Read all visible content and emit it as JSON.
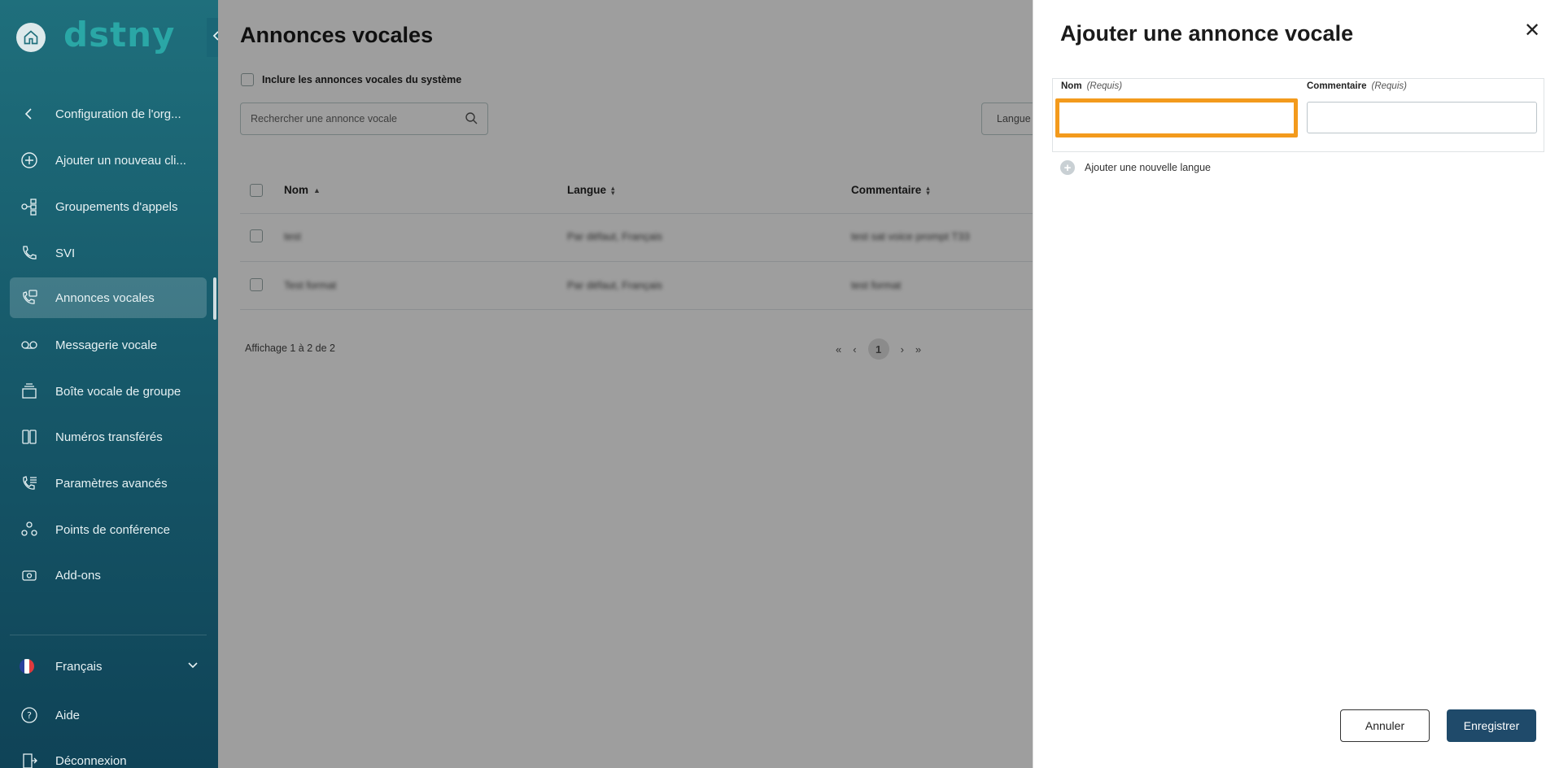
{
  "sidebar": {
    "logo": "dstny",
    "items": [
      {
        "label": "Configuration de l'org...",
        "icon": "chevron-left-icon"
      },
      {
        "label": "Ajouter un nouveau cli...",
        "icon": "plus-circle-icon"
      },
      {
        "label": "Groupements d'appels",
        "icon": "hunt-group-icon"
      },
      {
        "label": "SVI",
        "icon": "ivr-icon"
      },
      {
        "label": "Annonces vocales",
        "icon": "voice-announcement-icon",
        "active": true
      },
      {
        "label": "Messagerie vocale",
        "icon": "voicemail-icon"
      },
      {
        "label": "Boîte vocale de groupe",
        "icon": "group-voicemail-icon"
      },
      {
        "label": "Numéros transférés",
        "icon": "transferred-numbers-icon"
      },
      {
        "label": "Paramètres avancés",
        "icon": "advanced-settings-icon"
      },
      {
        "label": "Points de conférence",
        "icon": "conference-icon"
      },
      {
        "label": "Add-ons",
        "icon": "addons-icon"
      }
    ],
    "language": "Français",
    "help": "Aide",
    "logout": "Déconnexion"
  },
  "main": {
    "title": "Annonces vocales",
    "include_system_label": "Inclure les annonces vocales du système",
    "search_placeholder": "Rechercher une annonce vocale",
    "language_filter": "Langue",
    "columns": [
      "Nom",
      "Langue",
      "Commentaire"
    ],
    "rows": [
      {
        "name": "test",
        "language": "Par défaut, Français",
        "comment": "test sat voice prompt T33"
      },
      {
        "name": "Test format",
        "language": "Par défaut, Français",
        "comment": "test format"
      }
    ],
    "pagination_info": "Affichage 1 à 2 de 2",
    "current_page": "1"
  },
  "panel": {
    "title": "Ajouter une annonce vocale",
    "name_label": "Nom",
    "name_required": "(Requis)",
    "comment_label": "Commentaire",
    "comment_required": "(Requis)",
    "name_value": "",
    "comment_value": "",
    "add_language": "Ajouter une nouvelle langue",
    "cancel": "Annuler",
    "save": "Enregistrer"
  },
  "colors": {
    "sidebar_top": "#1f6f7c",
    "sidebar_bottom": "#0f4357",
    "focus": "#f39a1c",
    "primary_button": "#1f4a6a"
  }
}
